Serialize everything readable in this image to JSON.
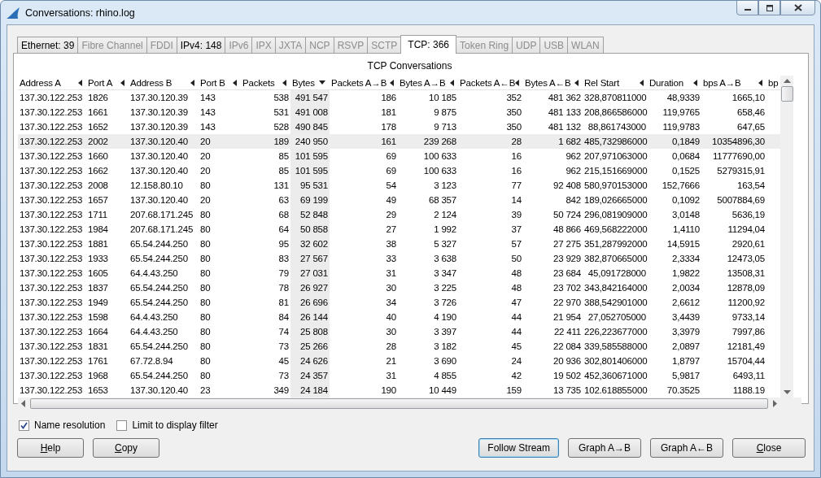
{
  "window": {
    "title": "Conversations: rhino.log"
  },
  "tabs": [
    {
      "label": "Ethernet: 39",
      "selected": false,
      "disabled": false
    },
    {
      "label": "Fibre Channel",
      "selected": false,
      "disabled": true
    },
    {
      "label": "FDDI",
      "selected": false,
      "disabled": true
    },
    {
      "label": "IPv4: 148",
      "selected": false,
      "disabled": false
    },
    {
      "label": "IPv6",
      "selected": false,
      "disabled": true
    },
    {
      "label": "IPX",
      "selected": false,
      "disabled": true
    },
    {
      "label": "JXTA",
      "selected": false,
      "disabled": true
    },
    {
      "label": "NCP",
      "selected": false,
      "disabled": true
    },
    {
      "label": "RSVP",
      "selected": false,
      "disabled": true
    },
    {
      "label": "SCTP",
      "selected": false,
      "disabled": true
    },
    {
      "label": "TCP: 366",
      "selected": true,
      "disabled": false
    },
    {
      "label": "Token Ring",
      "selected": false,
      "disabled": true
    },
    {
      "label": "UDP",
      "selected": false,
      "disabled": true
    },
    {
      "label": "USB",
      "selected": false,
      "disabled": true
    },
    {
      "label": "WLAN",
      "selected": false,
      "disabled": true
    }
  ],
  "table": {
    "title": "TCP Conversations",
    "columns": [
      {
        "label": "Address A",
        "kind": "text",
        "sorted": false
      },
      {
        "label": "Port A",
        "kind": "text",
        "sorted": false
      },
      {
        "label": "Address B",
        "kind": "text",
        "sorted": false
      },
      {
        "label": "Port B",
        "kind": "text",
        "sorted": false
      },
      {
        "label": "Packets",
        "kind": "number",
        "sorted": false
      },
      {
        "label": "Bytes",
        "kind": "number",
        "sorted": true
      },
      {
        "label": "Packets A→B",
        "kind": "number",
        "sorted": false
      },
      {
        "label": "Bytes A→B",
        "kind": "number",
        "sorted": false
      },
      {
        "label": "Packets A←B",
        "kind": "number",
        "sorted": false
      },
      {
        "label": "Bytes A←B",
        "kind": "number",
        "sorted": false
      },
      {
        "label": "Rel Start",
        "kind": "number",
        "sorted": false
      },
      {
        "label": "Duration",
        "kind": "number",
        "sorted": false
      },
      {
        "label": "bps A→B",
        "kind": "number",
        "sorted": false
      },
      {
        "label": "bp",
        "kind": "cut"
      }
    ],
    "rows": [
      {
        "selected": false,
        "cells": [
          "137.30.122.253",
          "1826",
          "137.30.120.39",
          "143",
          "538",
          "491 547",
          "186",
          "10 185",
          "352",
          "481 362",
          "328,870811000",
          "48,9339",
          "1665,10"
        ]
      },
      {
        "selected": false,
        "cells": [
          "137.30.122.253",
          "1661",
          "137.30.120.39",
          "143",
          "531",
          "491 008",
          "181",
          "9 875",
          "350",
          "481 133",
          "208,866586000",
          "119,9765",
          "658,46"
        ]
      },
      {
        "selected": false,
        "cells": [
          "137.30.122.253",
          "1652",
          "137.30.120.39",
          "143",
          "528",
          "490 845",
          "178",
          "9 713",
          "350",
          "481 132",
          "88,861743000",
          "119,9783",
          "647,65"
        ]
      },
      {
        "selected": true,
        "cells": [
          "137.30.122.253",
          "2002",
          "137.30.120.40",
          "20",
          "189",
          "240 950",
          "161",
          "239 268",
          "28",
          "1 682",
          "485,732986000",
          "0,1849",
          "10354896,30"
        ]
      },
      {
        "selected": false,
        "cells": [
          "137.30.122.253",
          "1660",
          "137.30.120.40",
          "20",
          "85",
          "101 595",
          "69",
          "100 633",
          "16",
          "962",
          "207,971063000",
          "0,0684",
          "11777690,00"
        ]
      },
      {
        "selected": false,
        "cells": [
          "137.30.122.253",
          "1662",
          "137.30.120.40",
          "20",
          "85",
          "101 595",
          "69",
          "100 633",
          "16",
          "962",
          "215,151669000",
          "0,1525",
          "5279315,91"
        ]
      },
      {
        "selected": false,
        "cells": [
          "137.30.122.253",
          "2008",
          "12.158.80.10",
          "80",
          "131",
          "95 531",
          "54",
          "3 123",
          "77",
          "92 408",
          "580,970153000",
          "152,7666",
          "163,54"
        ]
      },
      {
        "selected": false,
        "cells": [
          "137.30.122.253",
          "1657",
          "137.30.120.40",
          "20",
          "63",
          "69 199",
          "49",
          "68 357",
          "14",
          "842",
          "189,026665000",
          "0,1092",
          "5007884,69"
        ]
      },
      {
        "selected": false,
        "cells": [
          "137.30.122.253",
          "1711",
          "207.68.171.245",
          "80",
          "68",
          "52 848",
          "29",
          "2 124",
          "39",
          "50 724",
          "296,081909000",
          "3,0148",
          "5636,19"
        ]
      },
      {
        "selected": false,
        "cells": [
          "137.30.122.253",
          "1984",
          "207.68.171.245",
          "80",
          "64",
          "50 858",
          "27",
          "1 992",
          "37",
          "48 866",
          "469,568222000",
          "1,4110",
          "11294,04"
        ]
      },
      {
        "selected": false,
        "cells": [
          "137.30.122.253",
          "1881",
          "65.54.244.250",
          "80",
          "95",
          "32 602",
          "38",
          "5 327",
          "57",
          "27 275",
          "351,287992000",
          "14,5915",
          "2920,61"
        ]
      },
      {
        "selected": false,
        "cells": [
          "137.30.122.253",
          "1933",
          "65.54.244.250",
          "80",
          "83",
          "27 567",
          "33",
          "3 638",
          "50",
          "23 929",
          "382,870665000",
          "2,3334",
          "12473,05"
        ]
      },
      {
        "selected": false,
        "cells": [
          "137.30.122.253",
          "1605",
          "64.4.43.250",
          "80",
          "79",
          "27 031",
          "31",
          "3 347",
          "48",
          "23 684",
          "45,091728000",
          "1,9822",
          "13508,31"
        ]
      },
      {
        "selected": false,
        "cells": [
          "137.30.122.253",
          "1837",
          "65.54.244.250",
          "80",
          "78",
          "26 927",
          "30",
          "3 225",
          "48",
          "23 702",
          "343,842164000",
          "2,0034",
          "12878,09"
        ]
      },
      {
        "selected": false,
        "cells": [
          "137.30.122.253",
          "1949",
          "65.54.244.250",
          "80",
          "81",
          "26 696",
          "34",
          "3 726",
          "47",
          "22 970",
          "388,542901000",
          "2,6612",
          "11200,92"
        ]
      },
      {
        "selected": false,
        "cells": [
          "137.30.122.253",
          "1598",
          "64.4.43.250",
          "80",
          "84",
          "26 144",
          "40",
          "4 190",
          "44",
          "21 954",
          "27,052705000",
          "3,4439",
          "9733,14"
        ]
      },
      {
        "selected": false,
        "cells": [
          "137.30.122.253",
          "1664",
          "64.4.43.250",
          "80",
          "74",
          "25 808",
          "30",
          "3 397",
          "44",
          "22 411",
          "226,223677000",
          "3,3979",
          "7997,86"
        ]
      },
      {
        "selected": false,
        "cells": [
          "137.30.122.253",
          "1831",
          "65.54.244.250",
          "80",
          "73",
          "25 266",
          "28",
          "3 182",
          "45",
          "22 084",
          "339,585588000",
          "2,0897",
          "12181,49"
        ]
      },
      {
        "selected": false,
        "cells": [
          "137.30.122.253",
          "1761",
          "67.72.8.94",
          "80",
          "45",
          "24 626",
          "21",
          "3 690",
          "24",
          "20 936",
          "302,801406000",
          "1,8797",
          "15704,44"
        ]
      },
      {
        "selected": false,
        "cells": [
          "137.30.122.253",
          "1968",
          "65.54.244.250",
          "80",
          "73",
          "24 357",
          "31",
          "4 855",
          "42",
          "19 502",
          "452,360671000",
          "5,9817",
          "6493,11"
        ]
      },
      {
        "selected": false,
        "cells": [
          "137.30.122.253",
          "1653",
          "137.30.120.40",
          "23",
          "349",
          "24 184",
          "190",
          "10 449",
          "159",
          "13 735",
          "102.618855000",
          "70.3525",
          "1188.19"
        ]
      }
    ]
  },
  "options": [
    {
      "label": "Name resolution",
      "checked": true
    },
    {
      "label": "Limit to display filter",
      "checked": false
    }
  ],
  "buttons_left": [
    {
      "label": "Help",
      "mnemonic": true,
      "default": false
    },
    {
      "label": "Copy",
      "mnemonic": true,
      "default": false
    }
  ],
  "buttons_right": [
    {
      "label": "Follow Stream",
      "mnemonic": false,
      "default": true
    },
    {
      "label": "Graph A→B",
      "mnemonic": false,
      "default": false
    },
    {
      "label": "Graph A←B",
      "mnemonic": false,
      "default": false
    },
    {
      "label": "Close",
      "mnemonic": true,
      "default": false
    }
  ]
}
